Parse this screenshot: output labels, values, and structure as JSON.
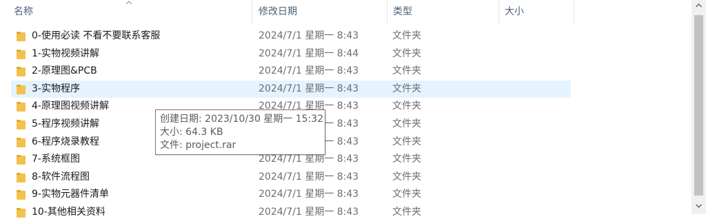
{
  "header": {
    "name_label": "名称",
    "date_label": "修改日期",
    "type_label": "类型",
    "size_label": "大小"
  },
  "colors": {
    "folder": "#f2c14e",
    "selected_row": "#e5f3ff",
    "header_text": "#4c607a"
  },
  "files": [
    {
      "name": "0-使用必读  不看不要联系客服",
      "date": "2024/7/1 星期一 8:43",
      "type": "文件夹"
    },
    {
      "name": "1-实物视频讲解",
      "date": "2024/7/1 星期一 8:44",
      "type": "文件夹"
    },
    {
      "name": "2-原理图&PCB",
      "date": "2024/7/1 星期一 8:43",
      "type": "文件夹"
    },
    {
      "name": "3-实物程序",
      "date": "2024/7/1 星期一 8:43",
      "type": "文件夹"
    },
    {
      "name": "4-原理图视频讲解",
      "date": "2024/7/1 星期一 8:43",
      "type": "文件夹"
    },
    {
      "name": "5-程序视频讲解",
      "date": "2024/7/1 星期一 8:43",
      "type": "文件夹"
    },
    {
      "name": "6-程序烧录教程",
      "date": "2024/7/1 星期一 8:43",
      "type": "文件夹"
    },
    {
      "name": "7-系统框图",
      "date": "2024/7/1 星期一 8:43",
      "type": "文件夹"
    },
    {
      "name": "8-软件流程图",
      "date": "2024/7/1 星期一 8:43",
      "type": "文件夹"
    },
    {
      "name": "9-实物元器件清单",
      "date": "2024/7/1 星期一 8:43",
      "type": "文件夹"
    },
    {
      "name": "10-其他相关资料",
      "date": "2024/7/1 星期一 8:43",
      "type": "文件夹"
    }
  ],
  "tooltip": {
    "created": "创建日期: 2023/10/30 星期一 15:32",
    "size": "大小: 64.3 KB",
    "files": "文件: project.rar"
  }
}
